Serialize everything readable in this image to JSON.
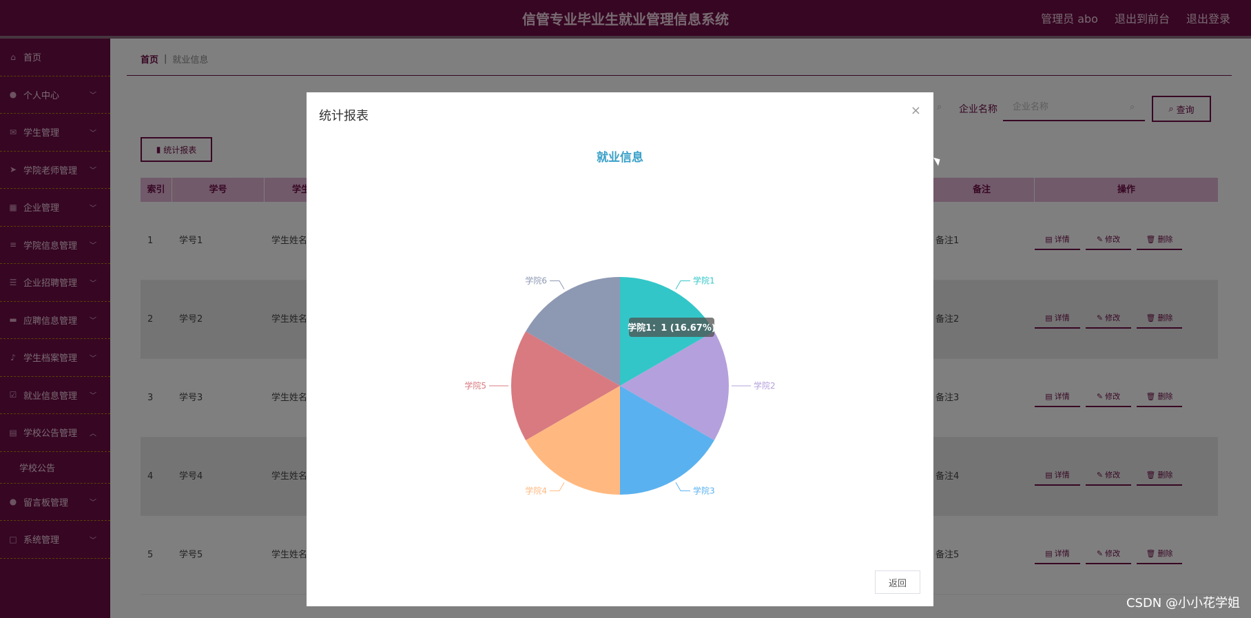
{
  "header": {
    "title": "信管专业毕业生就业管理信息系统",
    "admin": "管理员 abo",
    "to_front": "退出到前台",
    "logout": "退出登录"
  },
  "sidebar": {
    "items": [
      {
        "label": "首页",
        "icon": "home-icon",
        "glyph": "⌂"
      },
      {
        "label": "个人中心",
        "icon": "user-icon",
        "glyph": "●"
      },
      {
        "label": "学生管理",
        "icon": "mail-icon",
        "glyph": "✉"
      },
      {
        "label": "学院老师管理",
        "icon": "send-icon",
        "glyph": "➤"
      },
      {
        "label": "企业管理",
        "icon": "grid-icon",
        "glyph": "▦"
      },
      {
        "label": "学院信息管理",
        "icon": "list-icon",
        "glyph": "≡"
      },
      {
        "label": "企业招聘管理",
        "icon": "filter-icon",
        "glyph": "☰"
      },
      {
        "label": "应聘信息管理",
        "icon": "briefcase-icon",
        "glyph": "▬"
      },
      {
        "label": "学生档案管理",
        "icon": "mic-icon",
        "glyph": "♪"
      },
      {
        "label": "就业信息管理",
        "icon": "check-box-icon",
        "glyph": "☑"
      },
      {
        "label": "学校公告管理",
        "icon": "doc-icon",
        "glyph": "▤"
      }
    ],
    "sub_item": "学校公告",
    "after_items": [
      {
        "label": "留言板管理",
        "icon": "user-icon",
        "glyph": "●"
      },
      {
        "label": "系统管理",
        "icon": "square-icon",
        "glyph": "□"
      }
    ]
  },
  "breadcrumb": {
    "home": "首页",
    "sep": "|",
    "current": "就业信息"
  },
  "toolbar": {
    "stat_button": "统计报表",
    "search_label": "企业名称",
    "search_placeholder": "企业名称",
    "query_button": "查询"
  },
  "table": {
    "headers": [
      "索引",
      "学号",
      "学生",
      "备注",
      "操作"
    ],
    "rows": [
      {
        "idx": "1",
        "sno": "学号1",
        "name": "学生姓名",
        "note": "备注1"
      },
      {
        "idx": "2",
        "sno": "学号2",
        "name": "学生姓名",
        "note": "备注2"
      },
      {
        "idx": "3",
        "sno": "学号3",
        "name": "学生姓名",
        "note": "备注3"
      },
      {
        "idx": "4",
        "sno": "学号4",
        "name": "学生姓名",
        "note": "备注4"
      },
      {
        "idx": "5",
        "sno": "学号5",
        "name": "学生姓名",
        "note": "备注5"
      }
    ],
    "ops": {
      "detail": "详情",
      "edit": "修改",
      "delete": "删除"
    }
  },
  "modal": {
    "title": "统计报表",
    "close": "×",
    "return_button": "返回"
  },
  "chart_data": {
    "type": "pie",
    "title": "就业信息",
    "categories": [
      "学院1",
      "学院2",
      "学院3",
      "学院4",
      "学院5",
      "学院6"
    ],
    "values": [
      1,
      1,
      1,
      1,
      1,
      1
    ],
    "colors": [
      "#33c6c8",
      "#b4a0dc",
      "#5ab1ef",
      "#ffb980",
      "#d87a80",
      "#8d98b3"
    ],
    "tooltip": "学院1：1 (16.67%)"
  },
  "watermark": "CSDN @小小花学姐"
}
